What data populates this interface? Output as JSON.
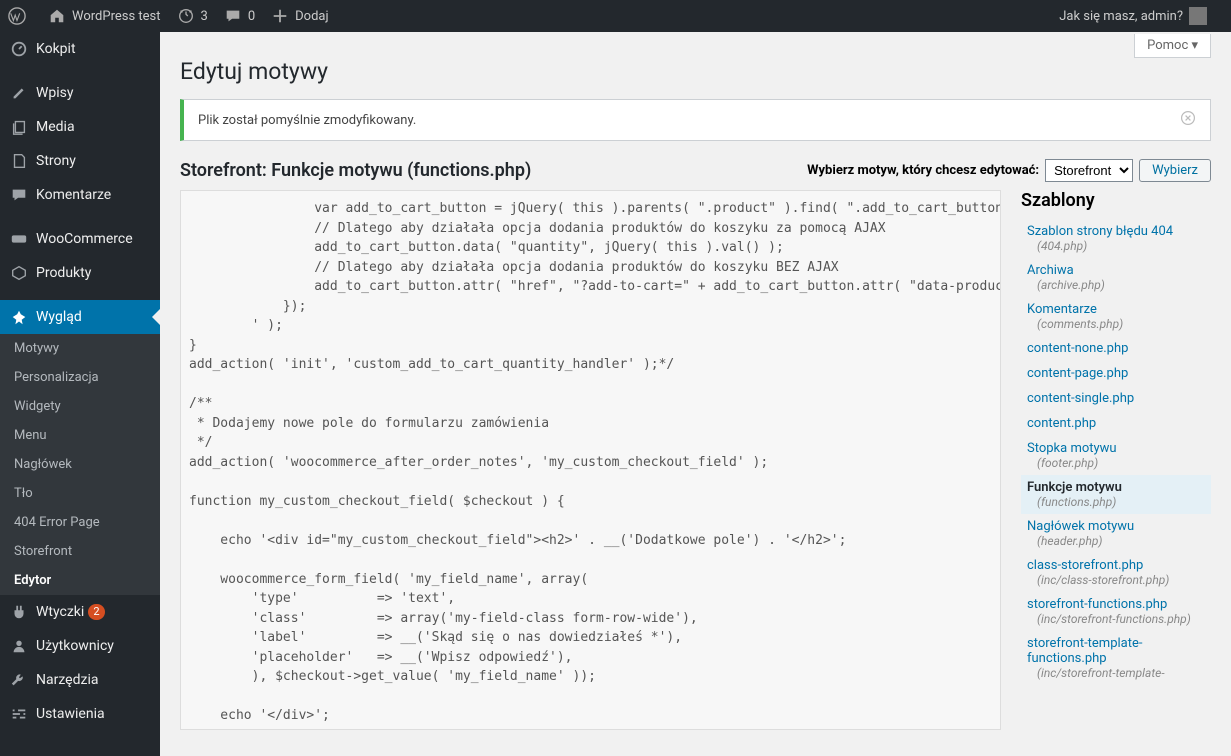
{
  "adminbar": {
    "site_title": "WordPress test",
    "updates": "3",
    "comments": "0",
    "add_new": "Dodaj",
    "howdy": "Jak się masz, admin?"
  },
  "sidebar": {
    "items": [
      {
        "label": "Kokpit"
      },
      {
        "label": "Wpisy"
      },
      {
        "label": "Media"
      },
      {
        "label": "Strony"
      },
      {
        "label": "Komentarze"
      },
      {
        "label": "WooCommerce"
      },
      {
        "label": "Produkty"
      },
      {
        "label": "Wygląd"
      },
      {
        "label": "Wtyczki",
        "badge": "2"
      },
      {
        "label": "Użytkownicy"
      },
      {
        "label": "Narzędzia"
      },
      {
        "label": "Ustawienia"
      }
    ],
    "submenu": [
      "Motywy",
      "Personalizacja",
      "Widgety",
      "Menu",
      "Nagłówek",
      "Tło",
      "404 Error Page",
      "Storefront",
      "Edytor"
    ]
  },
  "content": {
    "help": "Pomoc ▾",
    "page_title": "Edytuj motywy",
    "notice": "Plik został pomyślnie zmodyfikowany.",
    "editor_heading": "Storefront: Funkcje motywu (functions.php)",
    "select_label": "Wybierz motyw, który chcesz edytować:",
    "selected_theme": "Storefront",
    "select_button": "Wybierz",
    "templates_heading": "Szablony",
    "code": "                var add_to_cart_button = jQuery( this ).parents( \".product\" ).find( \".add_to_cart_button\" );\n                // Dlatego aby działała opcja dodania produktów do koszyku za pomocą AJAX\n                add_to_cart_button.data( \"quantity\", jQuery( this ).val() );\n                // Dlatego aby działała opcja dodania produktów do koszyku BEZ AJAX\n                add_to_cart_button.attr( \"href\", \"?add-to-cart=\" + add_to_cart_button.attr( \"data-product_id\" ) + \"&quantity=\" + jQuery( this ).val() );\n            });\n        ' );\n}\nadd_action( 'init', 'custom_add_to_cart_quantity_handler' );*/\n\n/**\n * Dodajemy nowe pole do formularzu zamówienia\n */\nadd_action( 'woocommerce_after_order_notes', 'my_custom_checkout_field' );\n\nfunction my_custom_checkout_field( $checkout ) {\n\n    echo '<div id=\"my_custom_checkout_field\"><h2>' . __('Dodatkowe pole') . '</h2>';\n\n    woocommerce_form_field( 'my_field_name', array(\n        'type'          => 'text',\n        'class'         => array('my-field-class form-row-wide'),\n        'label'         => __('Skąd się o nas dowiedziałeś *'),\n        'placeholder'   => __('Wpisz odpowiedź'),\n        ), $checkout->get_value( 'my_field_name' ));\n\n    echo '</div>';\n",
    "files": [
      {
        "label": "Szablon strony błędu 404",
        "fn": "(404.php)"
      },
      {
        "label": "Archiwa",
        "fn": "(archive.php)"
      },
      {
        "label": "Komentarze",
        "fn": "(comments.php)"
      },
      {
        "label": "content-none.php"
      },
      {
        "label": "content-page.php"
      },
      {
        "label": "content-single.php"
      },
      {
        "label": "content.php"
      },
      {
        "label": "Stopka motywu",
        "fn": "(footer.php)"
      },
      {
        "label": "Funkcje motywu",
        "fn": "(functions.php)",
        "active": true
      },
      {
        "label": "Nagłówek motywu",
        "fn": "(header.php)"
      },
      {
        "label": "class-storefront.php",
        "fn": "(inc/class-storefront.php)"
      },
      {
        "label": "storefront-functions.php",
        "fn": "(inc/storefront-functions.php)"
      },
      {
        "label": "storefront-template-functions.php",
        "fn": "(inc/storefront-template-"
      }
    ]
  }
}
